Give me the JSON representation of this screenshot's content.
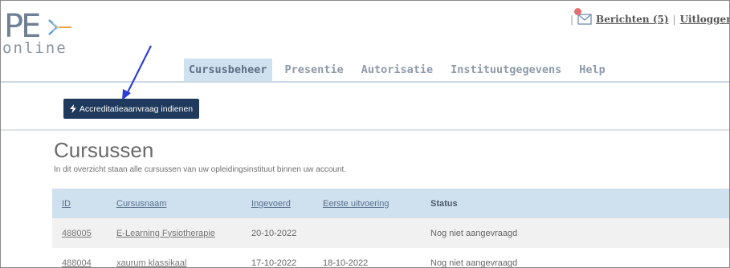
{
  "header": {
    "logo": {
      "main": "PE",
      "sub": "online"
    },
    "topbar": {
      "separator": "|",
      "messages_label": "Berichten (5)",
      "logout_label": "Uitloggen",
      "truncated_label": "N"
    },
    "nav": {
      "tabs": [
        {
          "label": "Cursusbeheer",
          "active": true
        },
        {
          "label": "Presentie",
          "active": false
        },
        {
          "label": "Autorisatie",
          "active": false
        },
        {
          "label": "Instituutgegevens",
          "active": false
        },
        {
          "label": "Help",
          "active": false
        }
      ]
    }
  },
  "toolbar": {
    "accreditation_button_label": "Accreditatieaanvraag indienen",
    "button_icon": "lightning-icon"
  },
  "main": {
    "title": "Cursussen",
    "subtitle": "In dit overzicht staan alle cursussen van uw opleidingsinstituut binnen uw account."
  },
  "table": {
    "columns": [
      "ID",
      "Cursusnaam",
      "Ingevoerd",
      "Eerste uitvoering",
      "Status"
    ],
    "rows": [
      {
        "id": "488005",
        "name": "E-Learning Fysiotherapie",
        "ingevoerd": "20-10-2022",
        "eerste": "",
        "status": "Nog niet aangevraagd"
      },
      {
        "id": "488004",
        "name": "xaurum klassikaal",
        "ingevoerd": "17-10-2022",
        "eerste": "18-10-2022",
        "status": "Nog niet aangevraagd"
      }
    ]
  },
  "colors": {
    "button_bg": "#1f3a5c",
    "nav_active_bg": "#cfe1ee",
    "table_header_bg": "#cfe0ef",
    "arrow": "#2c3ed8",
    "logo_accent": "#f0a040"
  }
}
